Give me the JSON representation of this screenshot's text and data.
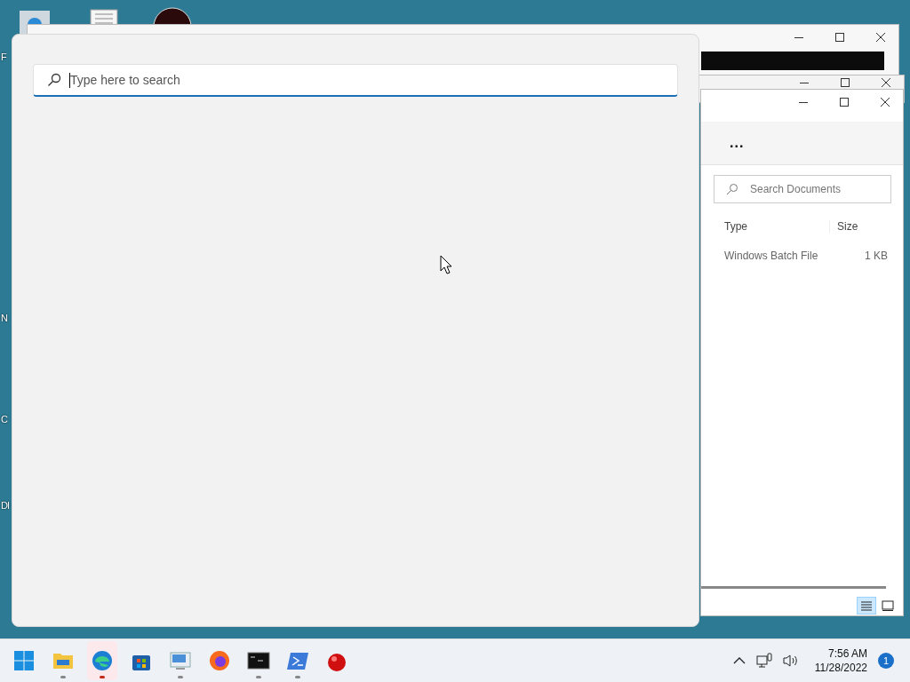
{
  "desktop": {
    "label_fragments": [
      {
        "text": "F"
      },
      {
        "text": "N"
      },
      {
        "text": "C"
      },
      {
        "text": "DI"
      }
    ]
  },
  "explorer": {
    "more": "...",
    "search": {
      "placeholder": "Search Documents"
    },
    "columns": [
      "Type",
      "Size"
    ],
    "rows": [
      {
        "type": "Windows Batch File",
        "size": "1 KB"
      }
    ],
    "views": [
      {
        "kind": "details",
        "selected": true
      },
      {
        "kind": "tiles",
        "selected": false
      }
    ]
  },
  "search_panel": {
    "search": {
      "placeholder": "Type here to search"
    }
  },
  "taskbar": {
    "apps": [
      {
        "kind": "start",
        "running": false,
        "selected": false
      },
      {
        "kind": "folder",
        "running": true,
        "selected": false
      },
      {
        "kind": "edge",
        "running": true,
        "selected": true
      },
      {
        "kind": "store",
        "running": false,
        "selected": false
      },
      {
        "kind": "remote",
        "running": true,
        "selected": false
      },
      {
        "kind": "firefox",
        "running": false,
        "selected": false
      },
      {
        "kind": "terminal",
        "running": true,
        "selected": false
      },
      {
        "kind": "powershell",
        "running": true,
        "selected": false
      },
      {
        "kind": "ball",
        "running": false,
        "selected": false
      }
    ],
    "time": "7:56 AM",
    "date": "11/28/2022",
    "notifications": "1"
  }
}
